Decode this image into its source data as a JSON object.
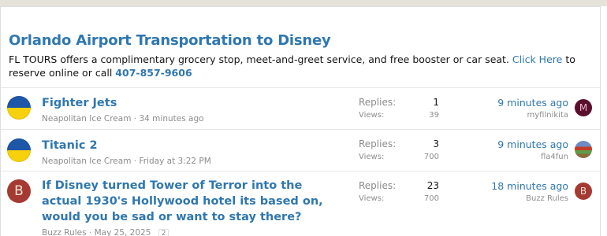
{
  "notice": {
    "title": "Orlando Airport Transportation to Disney",
    "body_text": "FL TOURS offers a complimentary grocery stop, meet-and-greet service, and free booster or car seat.",
    "link_text": "Click Here",
    "after_link": "to reserve online or call",
    "phone": "407-857-9606"
  },
  "threads": [
    {
      "title": "Fighter Jets",
      "author": "Neapolitan Ice Cream",
      "separator": "·",
      "started": "34 minutes ago",
      "replies_label": "Replies:",
      "replies": "1",
      "views_label": "Views:",
      "views": "39",
      "last_time": "9 minutes ago",
      "last_user": "myfilnikita",
      "last_avatar_letter": "M"
    },
    {
      "title": "Titanic 2",
      "author": "Neapolitan Ice Cream",
      "separator": "·",
      "started": "Friday at 3:22 PM",
      "replies_label": "Replies:",
      "replies": "3",
      "views_label": "Views:",
      "views": "700",
      "last_time": "9 minutes ago",
      "last_user": "fla4fun"
    },
    {
      "title": "If Disney turned Tower of Terror into the actual 1930's Hollywood hotel its based on, would you be sad or want to stay there?",
      "author": "Buzz Rules",
      "separator": "·",
      "started": "May 25, 2025",
      "page_badge": "2",
      "avatar_letter": "B",
      "replies_label": "Replies:",
      "replies": "23",
      "views_label": "Views:",
      "views": "700",
      "last_time": "18 minutes ago",
      "last_user": "Buzz Rules",
      "last_avatar_letter": "B"
    }
  ]
}
